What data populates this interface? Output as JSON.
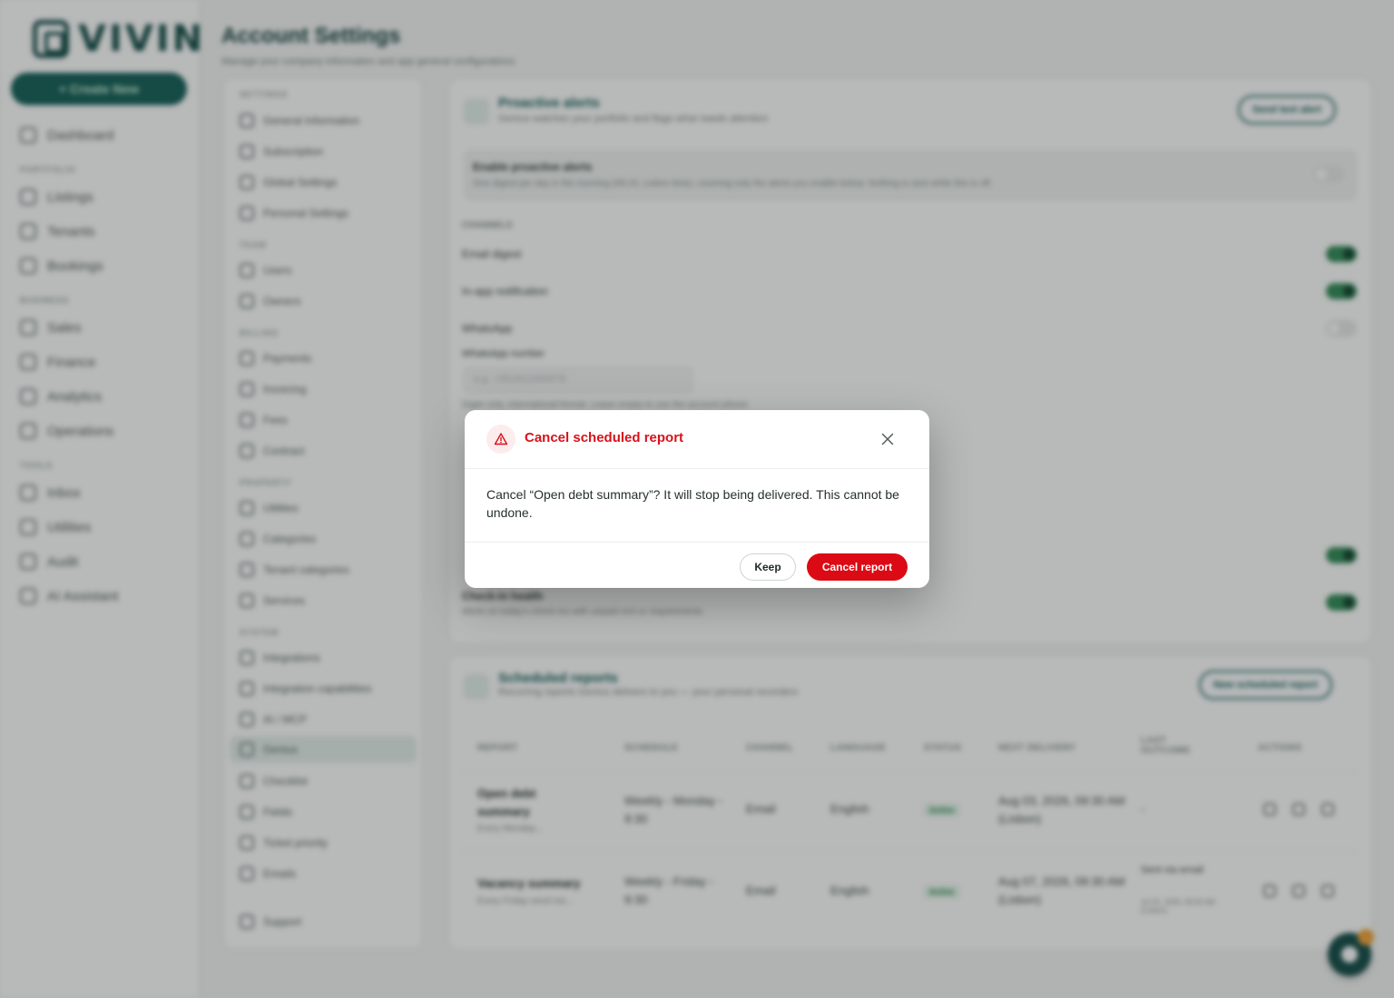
{
  "app": {
    "logo_text": "VIVIN",
    "create_button": "+ Create New",
    "nav": {
      "dashboard": "Dashboard",
      "section_portfolio": "PORTFOLIO",
      "listings": "Listings",
      "tenants": "Tenants",
      "bookings": "Bookings",
      "section_business": "BUSINESS",
      "sales": "Sales",
      "finance": "Finance",
      "analytics": "Analytics",
      "operations": "Operations",
      "section_tools": "TOOLS",
      "inbox": "Inbox",
      "utilities": "Utilities",
      "audit": "Audit",
      "ai_assistant": "AI Assistant"
    }
  },
  "page": {
    "title": "Account Settings",
    "subtitle": "Manage your company information and app general configurations"
  },
  "settings_nav": {
    "sec_settings": "SETTINGS",
    "general": "General Information",
    "subscription": "Subscription",
    "global": "Global Settings",
    "personal": "Personal Settings",
    "sec_team": "TEAM",
    "users": "Users",
    "owners": "Owners",
    "sec_billing": "BILLING",
    "payments": "Payments",
    "invoicing": "Invoicing",
    "fees": "Fees",
    "contract": "Contract",
    "sec_property": "PROPERTY",
    "utilities": "Utilities",
    "categories": "Categories",
    "tenant_categories": "Tenant categories",
    "services": "Services",
    "sec_system": "SYSTEM",
    "integrations": "Integrations",
    "integration_capabilities": "Integration capabilities",
    "ai_mcp": "AI / MCP",
    "genius": "Genius",
    "checklist": "Checklist",
    "fields": "Fields",
    "ticket_priority": "Ticket priority",
    "emails": "Emails",
    "support": "Support"
  },
  "alerts_card": {
    "title": "Proactive alerts",
    "subtitle": "Genius watches your portfolio and flags what needs attention",
    "test_button": "Send test alert",
    "enable_label": "Enable proactive alerts",
    "enable_desc": "One digest per day in the morning (09:15, Lisbon time), covering only the alerts you enable below. Nothing is sent while this is off.",
    "channels_label": "CHANNELS",
    "email_digest": "Email digest",
    "in_app": "In-app notification",
    "whatsapp": "WhatsApp",
    "whatsapp_number_label": "WhatsApp number",
    "whatsapp_placeholder": "e.g. +351912345678",
    "whatsapp_hint": "Digits only, international format. Leave empty to use the account phone.",
    "checkin_health": "Check-in health",
    "checkin_desc": "Alerts on today's check-ins with unpaid rent or requirements"
  },
  "reports_card": {
    "title": "Scheduled reports",
    "subtitle": "Recurring reports Genius delivers to you — your personal recorders",
    "new_button": "New scheduled report",
    "columns": [
      "REPORT",
      "SCHEDULE",
      "CHANNEL",
      "LANGUAGE",
      "STATUS",
      "NEXT DELIVERY",
      "LAST OUTCOME",
      "ACTIONS"
    ],
    "rows": [
      {
        "report": "Open debt summary",
        "report_sub": "Every Monday...",
        "schedule": "Weekly - Monday - 9:30",
        "channel": "Email",
        "language": "English",
        "status": "Active",
        "next": "Aug 03, 2026, 09:30 AM (Lisbon)",
        "last": "-",
        "last_sub": ""
      },
      {
        "report": "Vacancy summary",
        "report_sub": "Every Friday send me...",
        "schedule": "Weekly - Friday - 9:30",
        "channel": "Email",
        "language": "English",
        "status": "Active",
        "next": "Aug 07, 2026, 09:30 AM (Lisbon)",
        "last": "Sent via email",
        "last_sub": "Jul 31, 2026, 09:30 AM (Lisbon)"
      }
    ]
  },
  "modal": {
    "title": "Cancel scheduled report",
    "body": "Cancel “Open debt summary”? It will stop being delivered. This cannot be undone.",
    "keep_button": "Keep",
    "confirm_button": "Cancel report",
    "accent_color": "#dc0a14"
  }
}
